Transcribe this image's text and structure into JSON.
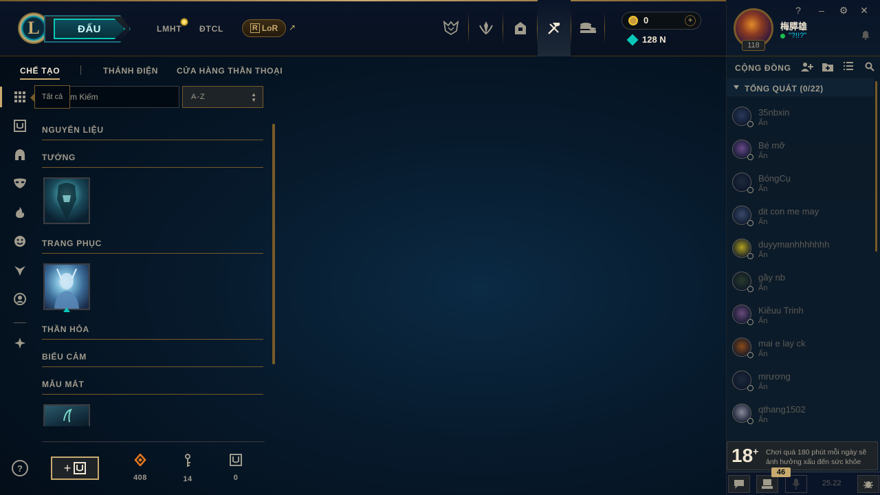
{
  "top_nav": {
    "play_label": "ĐẤU",
    "links": [
      "LMHT",
      "ĐTCL"
    ],
    "lor_label": "LoR",
    "lor_logo_letter": "R",
    "logo_letter": "L",
    "external_icon": "↗"
  },
  "top_icons": [
    "worlds-icon",
    "ranked-icon",
    "collection-icon",
    "loot-icon",
    "store-icon"
  ],
  "currency": {
    "rp": "0",
    "blue_essence": "128 N"
  },
  "profile": {
    "name": "梅膵雄",
    "status": "\"?!!?\"",
    "level": "118"
  },
  "window_controls": [
    "?",
    "–",
    "⚙",
    "✕"
  ],
  "subtabs": {
    "crafting": "CHẾ TẠO",
    "sanctum": "THÁNH ĐIỆN",
    "mythic_shop": "CỬA HÀNG THẦN THOẠI"
  },
  "filter": {
    "tooltip": "Tất cả",
    "search_value": "m Kiếm",
    "sort_value": "A-Z"
  },
  "categories": {
    "materials": "NGUYÊN LIỆU",
    "champions": "TƯỚNG",
    "skins": "TRANG PHỤC",
    "eternals": "THẦN HỎA",
    "emotes": "BIỂU CẢM",
    "ward_skins": "MẪU MẮT"
  },
  "resources": {
    "orange_essence": "408",
    "keys": "14",
    "chests": "0"
  },
  "social": {
    "header": "CỘNG ĐỒNG",
    "group": "TỔNG QUÁT (0/22)",
    "friends": [
      {
        "name": "35nbxin",
        "status": "Ẩn",
        "color": "#2a3a5a"
      },
      {
        "name": "Bé mỡ",
        "status": "Ẩn",
        "color": "#6a4a8a"
      },
      {
        "name": "BóngCụ",
        "status": "Ẩn",
        "color": "#1e2a3a"
      },
      {
        "name": "dit con me may",
        "status": "Ẩn",
        "color": "#3a4a6a"
      },
      {
        "name": "duyymanhhhhhhh",
        "status": "Ẩn",
        "color": "#b0a020"
      },
      {
        "name": "gầy nb",
        "status": "Ẩn",
        "color": "#2a3a2a"
      },
      {
        "name": "Kiềuu Trinh",
        "status": "Ẩn",
        "color": "#6a4a7a"
      },
      {
        "name": "mai e lay ck",
        "status": "Ẩn",
        "color": "#8a4a1a"
      },
      {
        "name": "mrương",
        "status": "Ẩn",
        "color": "#1e2a3a"
      },
      {
        "name": "qthang1502",
        "status": "Ẩn",
        "color": "#8a8a9a"
      }
    ]
  },
  "age_warning": {
    "badge": "18",
    "text": "Chơi quá 180 phút mỗi ngày sẽ ảnh hưởng xấu đến sức khỏe"
  },
  "footer": {
    "badge_count": "46",
    "version": "25.22"
  }
}
